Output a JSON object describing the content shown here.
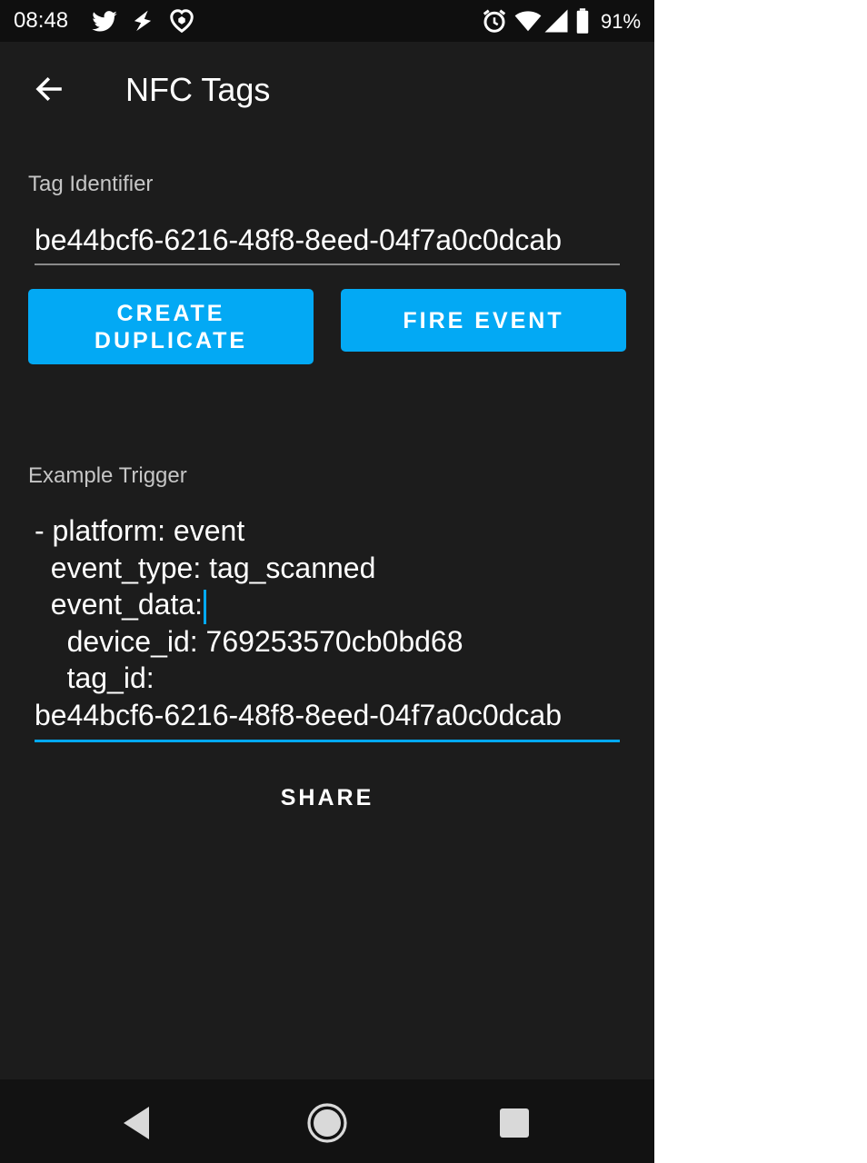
{
  "status_bar": {
    "time": "08:48",
    "battery": "91%",
    "icons": [
      "twitter-icon",
      "flash-icon",
      "shield-icon",
      "alarm-icon",
      "wifi-icon",
      "signal-icon",
      "battery-icon"
    ]
  },
  "app_bar": {
    "title": "NFC Tags",
    "back_icon": "arrow-left-icon"
  },
  "tag_identifier": {
    "label": "Tag Identifier",
    "value": "be44bcf6-6216-48f8-8eed-04f7a0c0dcab"
  },
  "buttons": {
    "create_duplicate_line1": "CREATE",
    "create_duplicate_line2": "DUPLICATE",
    "fire_event": "FIRE EVENT"
  },
  "example_trigger": {
    "label": "Example Trigger",
    "lines": [
      "- platform: event",
      "  event_type: tag_scanned",
      "  event_data:",
      "    device_id: 769253570cb0bd68",
      "    tag_id:",
      "be44bcf6-6216-48f8-8eed-04f7a0c0dcab"
    ]
  },
  "share": {
    "label": "SHARE"
  },
  "colors": {
    "accent": "#03a9f4",
    "background": "#1c1c1c",
    "status_bar": "#0f0f0f",
    "nav_bar": "#121212"
  },
  "nav_bar": {
    "icons": [
      "back-triangle-icon",
      "home-circle-icon",
      "recents-square-icon"
    ]
  }
}
